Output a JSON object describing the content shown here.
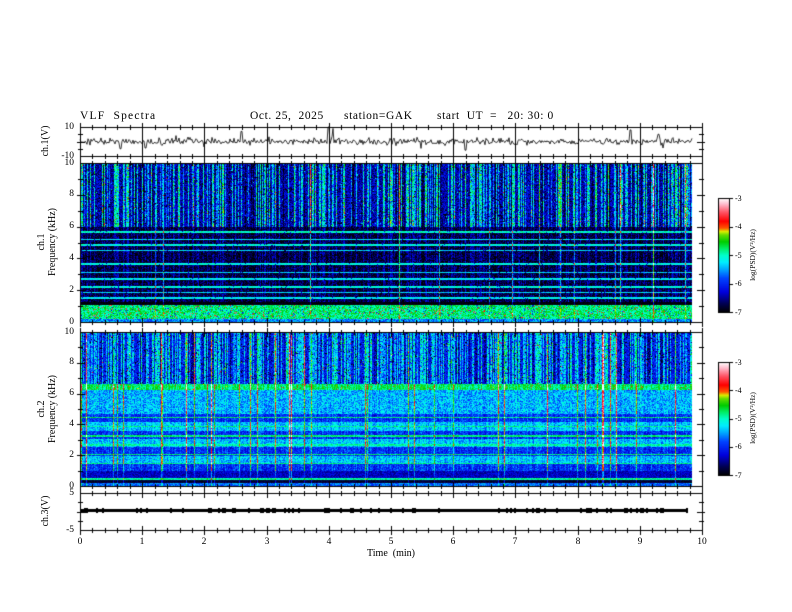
{
  "header": {
    "title": "VLF  Spectra",
    "date": "Oct. 25,  2025",
    "station": "station=GAK",
    "start_ut": "start  UT  =   20: 30: 0"
  },
  "x_axis": {
    "title": "Time  (min)",
    "range": [
      0,
      10
    ],
    "ticks": [
      0,
      1,
      2,
      3,
      4,
      5,
      6,
      7,
      8,
      9,
      10
    ],
    "minor_per_major": 4
  },
  "panels": {
    "ch1_wave": {
      "ylabel": "ch.1(V)",
      "y_range": [
        -10,
        10
      ],
      "y_ticks": [
        10,
        -10
      ]
    },
    "ch1_spec": {
      "ylabel_line1": "ch.1",
      "ylabel_line2": "Frequency  (kHz)",
      "y_range": [
        0,
        10
      ],
      "y_ticks": [
        10,
        8,
        6,
        4,
        2,
        0
      ]
    },
    "ch2_spec": {
      "ylabel_line1": "ch.2",
      "ylabel_line2": "Frequency  (kHz)",
      "y_range": [
        0,
        10
      ],
      "y_ticks": [
        10,
        8,
        6,
        4,
        2,
        0
      ]
    },
    "ch3_wave": {
      "ylabel": "ch.3(V)",
      "y_range": [
        -5,
        5
      ],
      "y_ticks": [
        5,
        -5
      ]
    }
  },
  "colorbar": {
    "label": "log(PSD)(V²/Hz)",
    "ticks": [
      -3,
      -4,
      -5,
      -6,
      -7
    ],
    "range": [
      -7,
      -3
    ]
  },
  "colors": {
    "background": "#ffffff",
    "foreground": "#000000",
    "palette": [
      [
        0.0,
        "#000000"
      ],
      [
        0.08,
        "#000055"
      ],
      [
        0.18,
        "#0000dd"
      ],
      [
        0.3,
        "#0044ff"
      ],
      [
        0.38,
        "#00aaff"
      ],
      [
        0.44,
        "#00eeff"
      ],
      [
        0.5,
        "#00ffcc"
      ],
      [
        0.56,
        "#00ee66"
      ],
      [
        0.62,
        "#00cc00"
      ],
      [
        0.68,
        "#66dd00"
      ],
      [
        0.71,
        "#ddee00"
      ],
      [
        0.74,
        "#ff5500"
      ],
      [
        0.8,
        "#ff0000"
      ],
      [
        0.88,
        "#ff5566"
      ],
      [
        0.95,
        "#ffbbcc"
      ],
      [
        1.0,
        "#ffffff"
      ]
    ]
  },
  "chart_data": [
    {
      "id": "ch1_waveform",
      "type": "line",
      "title": "ch.1(V) time series",
      "x_range": [
        0,
        10
      ],
      "y_range": [
        -10,
        10
      ],
      "data_end": 9.84,
      "seed": 303,
      "baseline": 0,
      "noise_amp": 1.0,
      "spikes": [
        {
          "t": 0.65,
          "v": -5
        },
        {
          "t": 1.05,
          "v": -4.5
        },
        {
          "t": 2.6,
          "v": 7
        },
        {
          "t": 4.0,
          "v": 10
        },
        {
          "t": 4.07,
          "v": 9
        },
        {
          "t": 6.2,
          "v": -6
        },
        {
          "t": 8.85,
          "v": 8
        },
        {
          "t": 9.3,
          "v": 5
        }
      ]
    },
    {
      "id": "ch1_spectrogram",
      "type": "heatmap",
      "title": "ch.1 VLF spectrogram",
      "x_range": [
        0,
        10
      ],
      "y_range": [
        0,
        10
      ],
      "value_range": [
        -7,
        -3
      ],
      "data_end": 9.84,
      "seed": 101,
      "streak_prob": 0.42,
      "streak_min": 0.9,
      "streak_var": 1.4,
      "dark_col_prob": 0.08,
      "full_line_prob": 0.025,
      "bright_line_prob": 0.004,
      "zones": [
        {
          "f": [
            9.93,
            10.0
          ],
          "base": -5.2,
          "col": 0.3,
          "noise": 2.0
        },
        {
          "f": [
            6.0,
            9.93
          ],
          "base": -6.45,
          "col": 1.0,
          "noise": 0.8,
          "speck_p": 0.012,
          "speck_v": 1.2,
          "dark_speck_p": 0.05
        },
        {
          "f": [
            1.25,
            6.0
          ],
          "base": -6.8,
          "col": 0.25,
          "noise": 0.7,
          "dark_speck_p": 0.04
        },
        {
          "f": [
            1.05,
            1.25
          ],
          "base": -6.95,
          "col": 0.0,
          "noise": 0.2
        },
        {
          "f": [
            0.2,
            1.05
          ],
          "base": -4.8,
          "col": 0.0,
          "noise": 0.7,
          "speck_p": 0.05,
          "speck_v": 1.1,
          "dark_speck_p": 0.05
        },
        {
          "f": [
            0.0,
            0.2
          ],
          "base": -5.6,
          "col": 0.0,
          "noise": 0.8
        }
      ],
      "h_lines": [
        {
          "f": 5.65,
          "v": -5.2
        },
        {
          "f": 5.2,
          "v": -5.4
        },
        {
          "f": 4.85,
          "v": -5.3
        },
        {
          "f": 4.5,
          "v": -5.5
        },
        {
          "f": 3.65,
          "v": -5.3
        },
        {
          "f": 3.1,
          "v": -5.5
        },
        {
          "f": 2.7,
          "v": -5.4
        },
        {
          "f": 2.2,
          "v": -5.3
        },
        {
          "f": 1.85,
          "v": -5.5
        },
        {
          "f": 1.5,
          "v": -5.4
        }
      ]
    },
    {
      "id": "ch2_spectrogram",
      "type": "heatmap",
      "title": "ch.2 VLF spectrogram",
      "x_range": [
        0,
        10
      ],
      "y_range": [
        0,
        10
      ],
      "value_range": [
        -7,
        -3
      ],
      "data_end": 9.84,
      "seed": 202,
      "streak_prob": 0.5,
      "streak_min": 0.7,
      "streak_var": 1.2,
      "dark_col_prob": 0.1,
      "full_line_prob": 0.035,
      "bright_line_prob": 0.012,
      "zones": [
        {
          "f": [
            9.93,
            10.0
          ],
          "base": -5.2,
          "col": 0.3,
          "noise": 2.0
        },
        {
          "f": [
            6.6,
            9.93
          ],
          "base": -6.15,
          "col": 0.9,
          "noise": 0.8,
          "speck_p": 0.01,
          "speck_v": 1.5,
          "dark_speck_p": 0.05
        },
        {
          "f": [
            6.25,
            6.6
          ],
          "base": -4.85,
          "col": 0.25,
          "noise": 0.5,
          "speck_p": 0.02,
          "speck_v": 0.9
        },
        {
          "f": [
            4.7,
            6.25
          ],
          "base": -5.5,
          "col": 0.15,
          "noise": 0.8
        },
        {
          "f": [
            1.0,
            4.7
          ],
          "base": -5.75,
          "col": 0.2,
          "noise": 0.7,
          "band_step": 0.55,
          "band_amp": 0.28
        },
        {
          "f": [
            0.55,
            1.0
          ],
          "base": -6.35,
          "col": 0.0,
          "noise": 0.5
        },
        {
          "f": [
            0.38,
            0.55
          ],
          "base": -4.9,
          "col": 0.0,
          "noise": 0.4
        },
        {
          "f": [
            0.2,
            0.38
          ],
          "base": -6.8,
          "col": 0.0,
          "noise": 0.3
        },
        {
          "f": [
            0.0,
            0.2
          ],
          "base": -5.7,
          "col": 0.0,
          "noise": 0.6
        }
      ],
      "h_lines": [
        {
          "f": 4.45,
          "v": -5.0
        },
        {
          "f": 3.85,
          "v": -5.05
        },
        {
          "f": 3.25,
          "v": -5.0
        },
        {
          "f": 2.65,
          "v": -5.1
        },
        {
          "f": 2.05,
          "v": -5.0
        },
        {
          "f": 1.45,
          "v": -5.05
        }
      ]
    },
    {
      "id": "ch3_trace",
      "type": "line",
      "title": "ch.3(V) time series",
      "x_range": [
        0,
        10
      ],
      "y_range": [
        -5,
        5
      ],
      "data_end": 9.78,
      "seed": 404,
      "value": 0.4,
      "thickness_volts": 0.8
    }
  ]
}
